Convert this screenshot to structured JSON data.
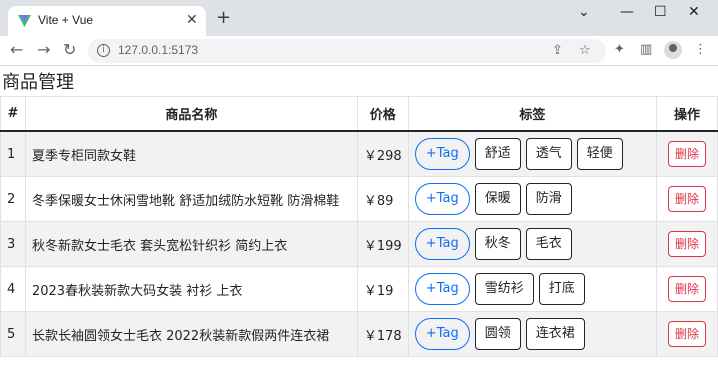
{
  "browser": {
    "tab_title": "Vite + Vue",
    "url": "127.0.0.1:5173"
  },
  "page": {
    "title": "商品管理",
    "headers": {
      "index": "#",
      "name": "商品名称",
      "price": "价格",
      "tags": "标签",
      "ops": "操作"
    },
    "add_tag_label": "+Tag",
    "delete_label": "删除",
    "rows": [
      {
        "id": "1",
        "name": "夏季专柜同款女鞋",
        "price": "￥298",
        "tags": [
          "舒适",
          "透气",
          "轻便"
        ]
      },
      {
        "id": "2",
        "name": "冬季保暖女士休闲雪地靴 舒适加绒防水短靴 防滑棉鞋",
        "price": "￥89",
        "tags": [
          "保暖",
          "防滑"
        ]
      },
      {
        "id": "3",
        "name": "秋冬新款女士毛衣 套头宽松针织衫 简约上衣",
        "price": "￥199",
        "tags": [
          "秋冬",
          "毛衣"
        ]
      },
      {
        "id": "4",
        "name": "2023春秋装新款大码女装 衬衫 上衣",
        "price": "￥19",
        "tags": [
          "雪纺衫",
          "打底"
        ]
      },
      {
        "id": "5",
        "name": "长款长袖圆领女士毛衣 2022秋装新款假两件连衣裙",
        "price": "￥178",
        "tags": [
          "圆领",
          "连衣裙"
        ]
      }
    ]
  },
  "colors": {
    "primary": "#0d6efd",
    "danger": "#dc3545"
  }
}
